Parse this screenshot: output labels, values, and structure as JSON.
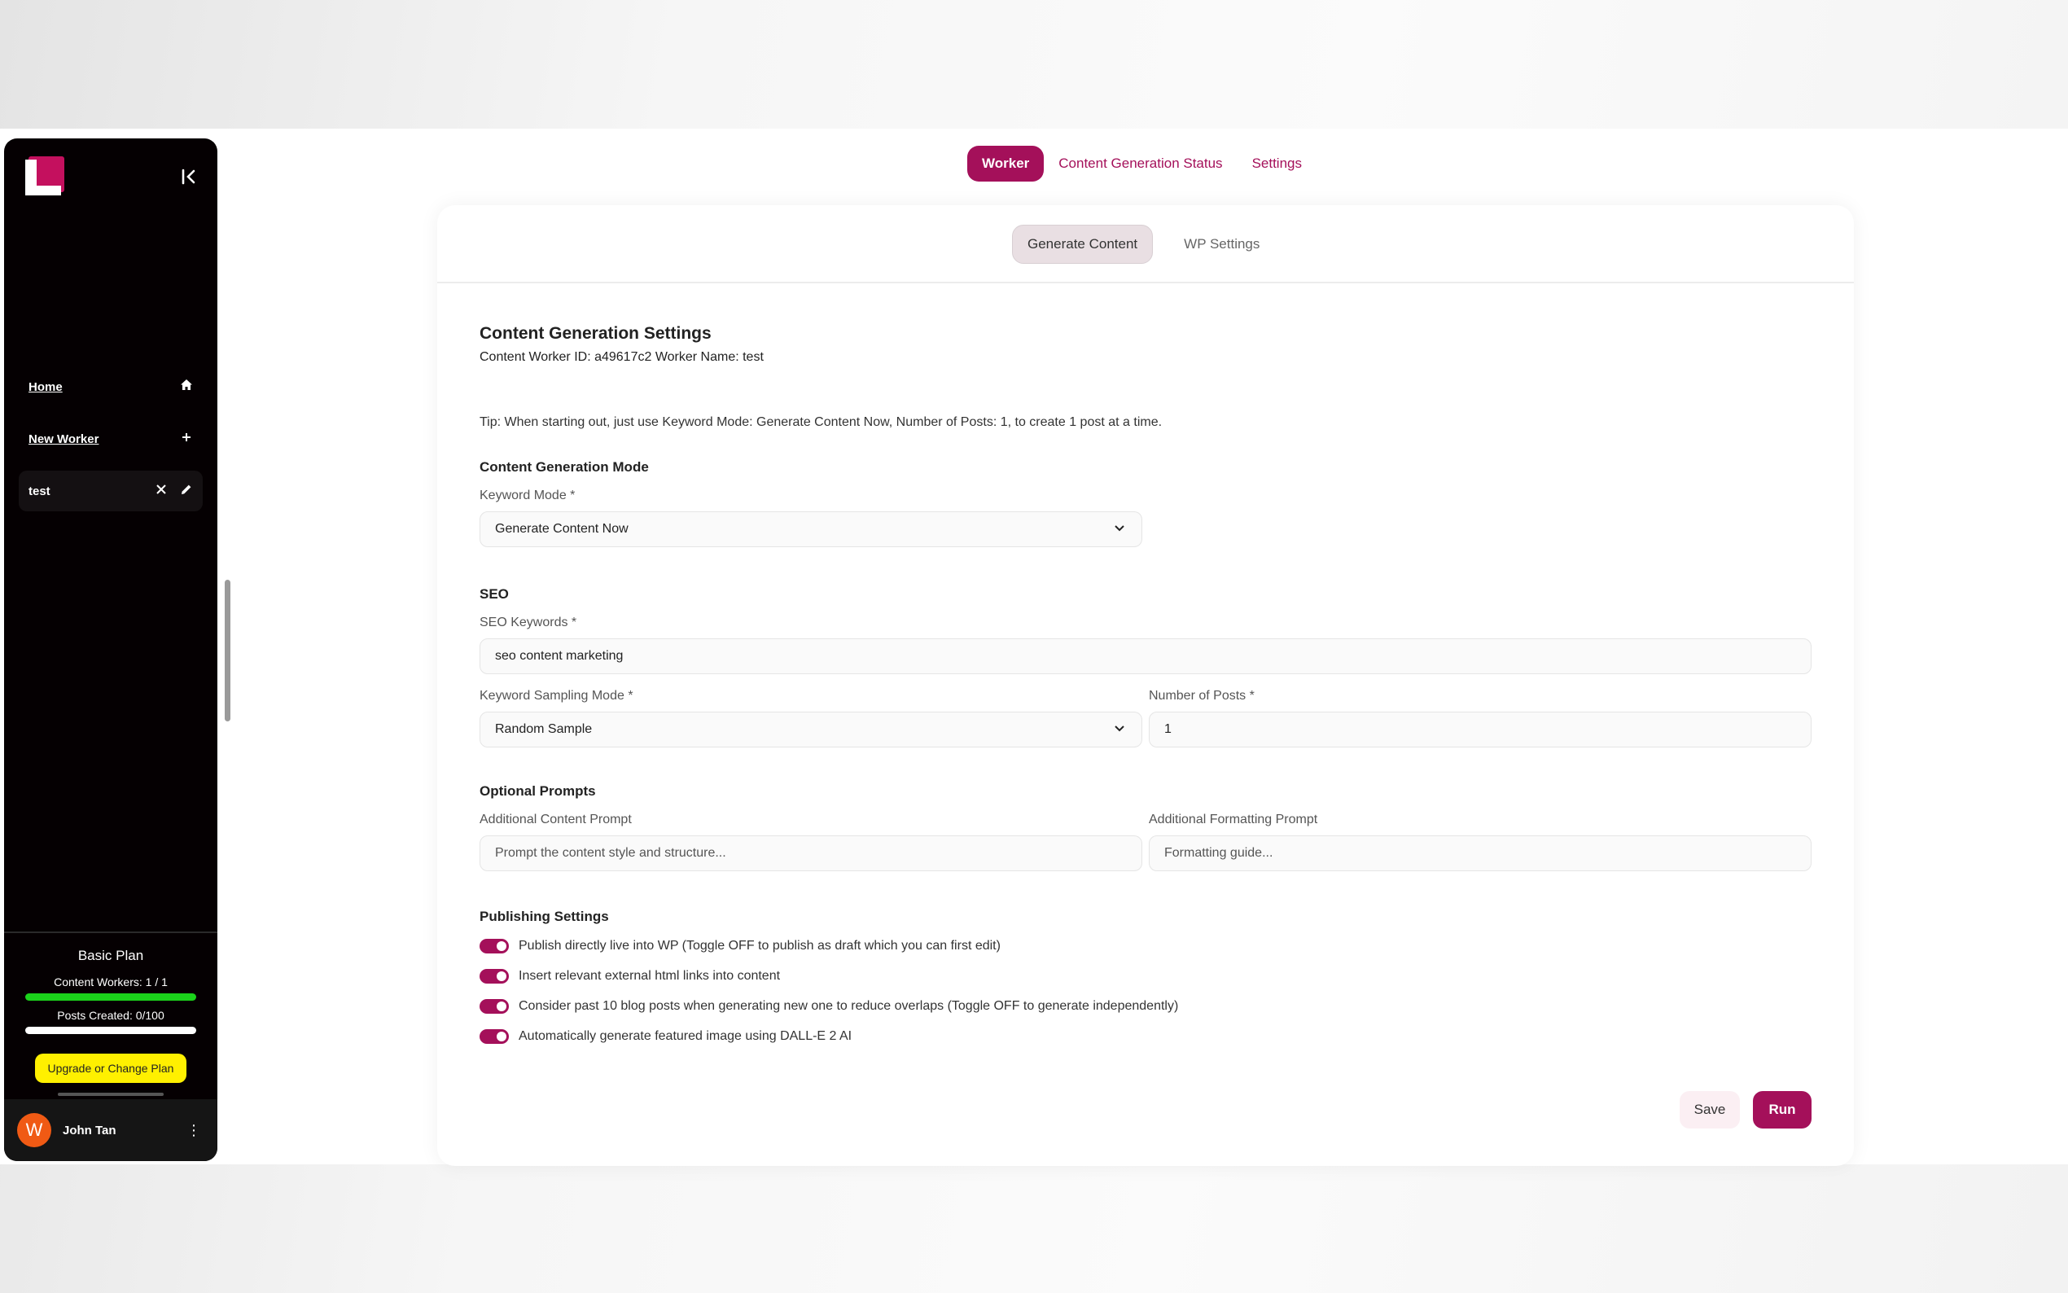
{
  "colors": {
    "accent": "#a4105a",
    "sidebar_bg": "#050002",
    "plan_bar": "#1bd31b",
    "upgrade": "#fff000",
    "avatar": "#f05a14"
  },
  "sidebar": {
    "nav": [
      {
        "label": "Home",
        "icon": "home-icon"
      },
      {
        "label": "New Worker",
        "icon": "plus-icon"
      }
    ],
    "worker": {
      "label": "test",
      "icons": [
        "close-icon",
        "pencil-icon"
      ]
    },
    "plan": {
      "title": "Basic Plan",
      "workers_text": "Content Workers: 1 / 1",
      "workers_progress": 1.0,
      "posts_text": "Posts Created: 0/100",
      "posts_progress": 0.0,
      "upgrade_label": "Upgrade or Change Plan"
    },
    "user": {
      "initial": "W",
      "name": "John Tan"
    }
  },
  "top_tabs": [
    {
      "label": "Worker",
      "active": true
    },
    {
      "label": "Content Generation Status",
      "active": false
    },
    {
      "label": "Settings",
      "active": false
    }
  ],
  "sub_tabs": [
    {
      "label": "Generate Content",
      "active": true
    },
    {
      "label": "WP Settings",
      "active": false
    }
  ],
  "form": {
    "title": "Content Generation Settings",
    "meta": "Content Worker ID: a49617c2 Worker Name: test",
    "tip": "Tip: When starting out, just use Keyword Mode: Generate Content Now, Number of Posts: 1, to create 1 post at a time.",
    "mode_section": "Content Generation Mode",
    "keyword_mode_label": "Keyword Mode *",
    "keyword_mode_value": "Generate Content Now",
    "seo_section": "SEO",
    "seo_keywords_label": "SEO Keywords *",
    "seo_keywords_value": "seo content marketing",
    "sampling_label": "Keyword Sampling Mode *",
    "sampling_value": "Random Sample",
    "posts_label": "Number of Posts *",
    "posts_value": "1",
    "prompts_section": "Optional Prompts",
    "content_prompt_label": "Additional Content Prompt",
    "content_prompt_placeholder": "Prompt the content style and structure...",
    "format_prompt_label": "Additional Formatting Prompt",
    "format_prompt_placeholder": "Formatting guide...",
    "publishing_section": "Publishing Settings",
    "toggles": [
      {
        "label": "Publish directly live into WP (Toggle OFF to publish as draft which you can first edit)",
        "on": true
      },
      {
        "label": "Insert relevant external html links into content",
        "on": true
      },
      {
        "label": "Consider past 10 blog posts when generating new one to reduce overlaps (Toggle OFF to generate independently)",
        "on": true
      },
      {
        "label": "Automatically generate featured image using DALL-E 2 AI",
        "on": true
      }
    ],
    "save_label": "Save",
    "run_label": "Run"
  }
}
